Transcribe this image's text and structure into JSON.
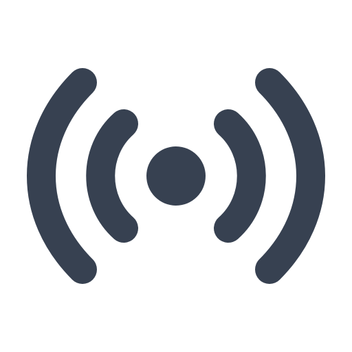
{
  "icon": {
    "name": "broadcast-icon",
    "color": "#374151",
    "background": "#ffffff"
  }
}
